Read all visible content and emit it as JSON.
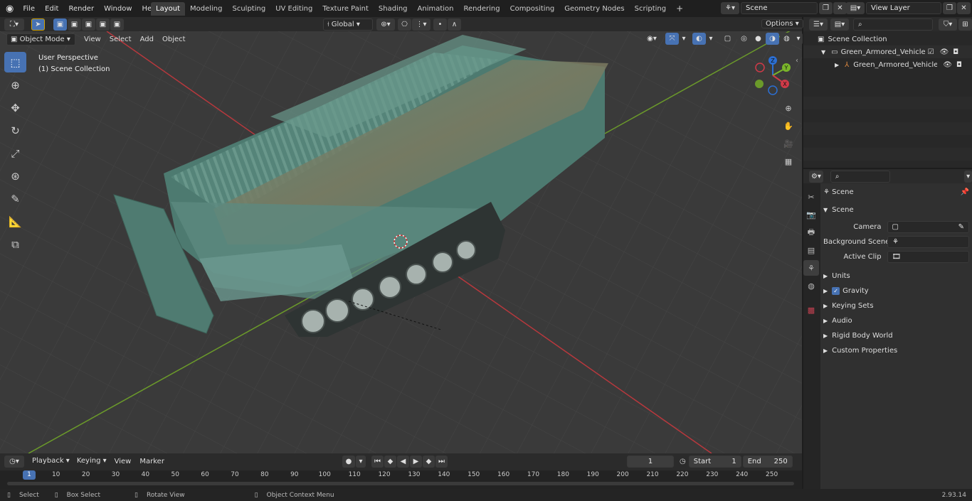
{
  "menu": [
    "File",
    "Edit",
    "Render",
    "Window",
    "Help"
  ],
  "workspaces": [
    "Layout",
    "Modeling",
    "Sculpting",
    "UV Editing",
    "Texture Paint",
    "Shading",
    "Animation",
    "Rendering",
    "Compositing",
    "Geometry Nodes",
    "Scripting"
  ],
  "active_workspace": "Layout",
  "scene_field": "Scene",
  "view_layer_field": "View Layer",
  "viewport": {
    "mode": "Object Mode",
    "menus": [
      "View",
      "Select",
      "Add",
      "Object"
    ],
    "transform_orientation": "Global",
    "options_label": "Options",
    "overlay_title": "User Perspective",
    "overlay_collection": "(1) Scene Collection",
    "gizmo_axes": {
      "x": "X",
      "y": "Y",
      "z": "Z"
    }
  },
  "outliner": {
    "root": "Scene Collection",
    "items": [
      "Green_Armored_Vehicle_Laun",
      "Green_Armored_Vehicle_"
    ]
  },
  "properties": {
    "context": "Scene",
    "section": "Scene",
    "fields": [
      {
        "label": "Camera",
        "value": ""
      },
      {
        "label": "Background Scene",
        "value": ""
      },
      {
        "label": "Active Clip",
        "value": ""
      }
    ],
    "panels": [
      "Units",
      "Gravity",
      "Keying Sets",
      "Audio",
      "Rigid Body World",
      "Custom Properties"
    ],
    "gravity_checked": true
  },
  "timeline": {
    "menus": [
      "Playback",
      "Keying",
      "View",
      "Marker"
    ],
    "current_frame": "1",
    "start_label": "Start",
    "start_value": "1",
    "end_label": "End",
    "end_value": "250",
    "ticks": [
      "1",
      "10",
      "20",
      "30",
      "40",
      "50",
      "60",
      "70",
      "80",
      "90",
      "100",
      "110",
      "120",
      "130",
      "140",
      "150",
      "160",
      "170",
      "180",
      "190",
      "200",
      "210",
      "220",
      "230",
      "240",
      "250"
    ]
  },
  "statusbar": {
    "items": [
      "Select",
      "Box Select",
      "Rotate View",
      "Object Context Menu"
    ],
    "version": "2.93.14"
  },
  "colors": {
    "accent": "#4772b3",
    "grid_x": "#b8383d",
    "grid_y": "#6b9a2a",
    "vehicle": "#4d7a70"
  }
}
